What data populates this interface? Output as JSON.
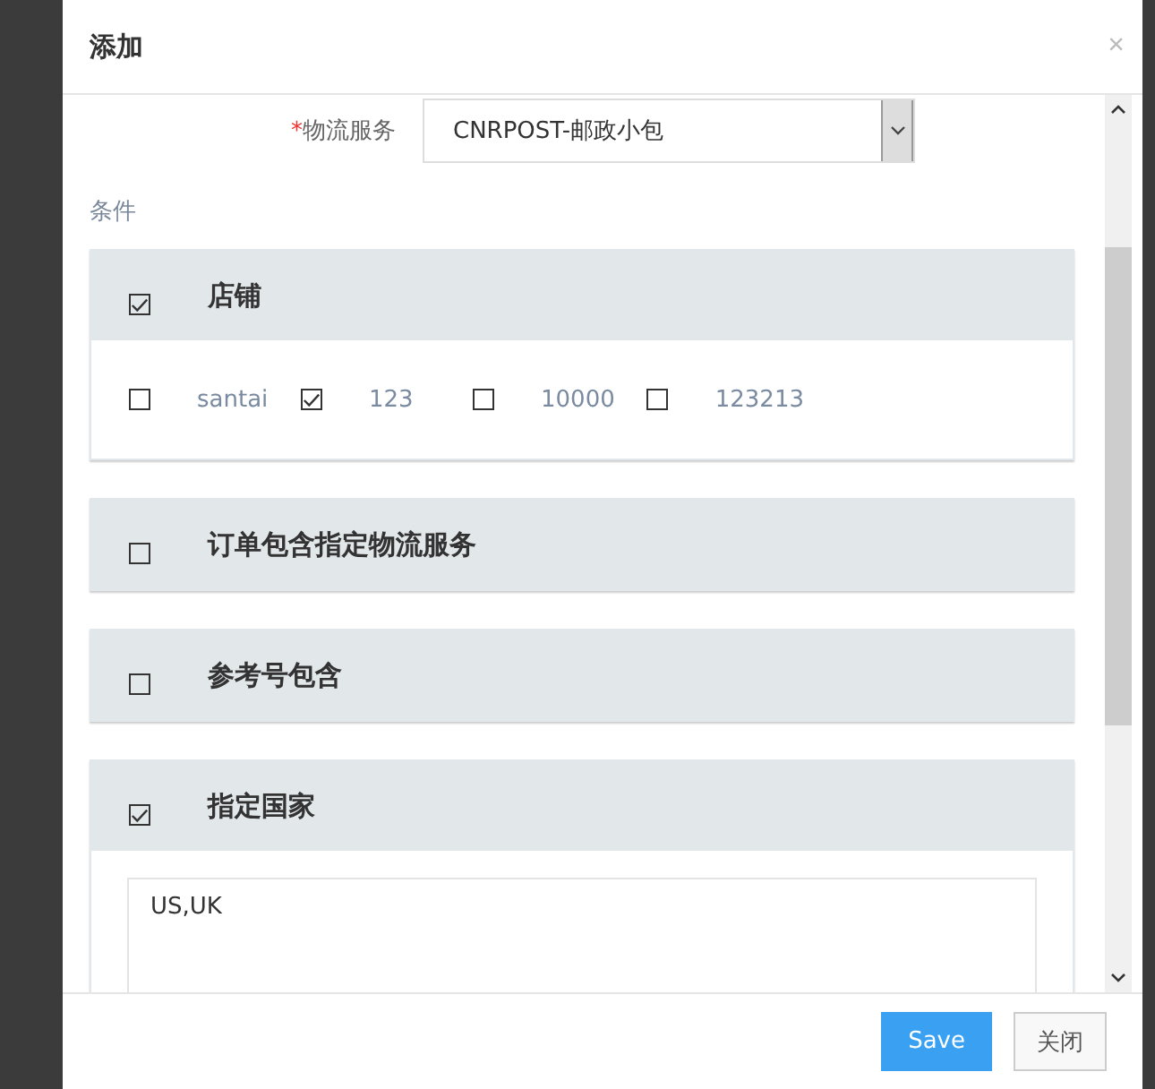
{
  "dialog": {
    "title": "添加",
    "close": "×"
  },
  "logistics_field": {
    "required_mark": "*",
    "label": "物流服务",
    "value": "CNRPOST-邮政小包"
  },
  "conditions_label": "条件",
  "sections": [
    {
      "kind": "options",
      "title": "店铺",
      "checked": true,
      "options": [
        {
          "label": "santai",
          "checked": false
        },
        {
          "label": "123",
          "checked": true
        },
        {
          "label": "10000",
          "checked": false
        },
        {
          "label": "123213",
          "checked": false
        }
      ]
    },
    {
      "kind": "plain",
      "title": "订单包含指定物流服务",
      "checked": false
    },
    {
      "kind": "plain",
      "title": "参考号包含",
      "checked": false
    },
    {
      "kind": "text",
      "title": "指定国家",
      "checked": true,
      "value": "US,UK"
    }
  ],
  "buttons": [
    {
      "label": "Save",
      "kind": "primary"
    },
    {
      "label": "关闭",
      "kind": "default"
    }
  ]
}
